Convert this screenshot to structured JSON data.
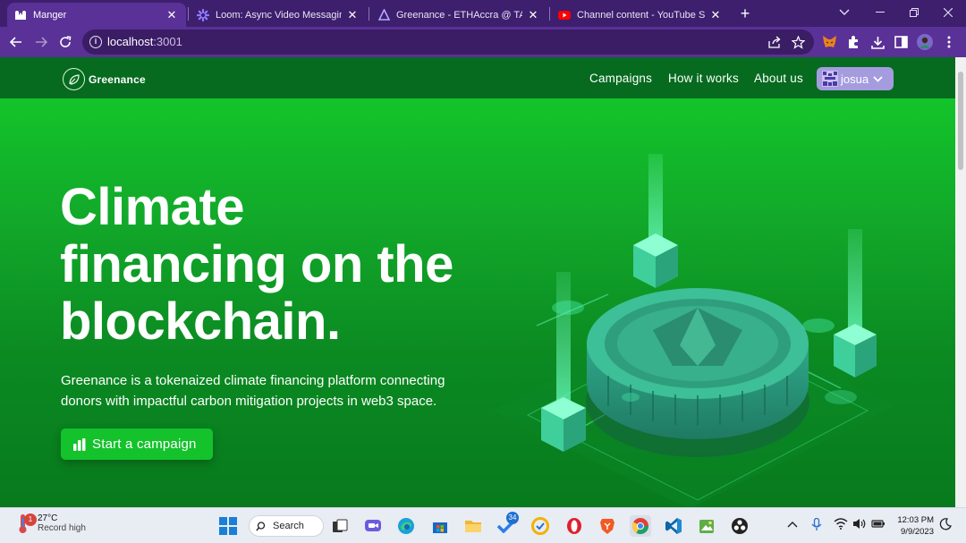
{
  "browser": {
    "tabs": [
      {
        "title": "Manger",
        "icon": "app-icon",
        "active": true
      },
      {
        "title": "Loom: Async Video Messaging for",
        "icon": "loom-icon",
        "active": false
      },
      {
        "title": "Greenance - ETHAccra @ TAIKAI",
        "icon": "taikai-icon",
        "active": false
      },
      {
        "title": "Channel content - YouTube Studio",
        "icon": "youtube-icon",
        "active": false
      }
    ],
    "url_host": "localhost",
    "url_port": ":3001"
  },
  "site": {
    "brand": "Greenance",
    "nav": [
      {
        "label": "Campaigns"
      },
      {
        "label": "How it works"
      },
      {
        "label": "About us"
      }
    ],
    "user": {
      "name": "josua"
    }
  },
  "hero": {
    "title_lines": [
      "Climate",
      "financing on the",
      "blockchain."
    ],
    "subtitle": "Greenance is a tokenaized climate financing platform connecting donors with impactful carbon mitigation projects in web3 space.",
    "cta_label": "Start a campaign"
  },
  "taskbar": {
    "weather_temp": "27°C",
    "weather_note": "Record high",
    "weather_badge": "1",
    "search_label": "Search",
    "todo_badge": "34",
    "time": "12:03 PM",
    "date": "9/9/2023"
  },
  "colors": {
    "chrome_tabstrip": "#3d1f6e",
    "chrome_toolbar": "#5a3196",
    "site_nav": "#066a1f",
    "hero_green": "#13c42a",
    "cta_green": "#14c22c",
    "user_pill": "#a59ce0"
  }
}
